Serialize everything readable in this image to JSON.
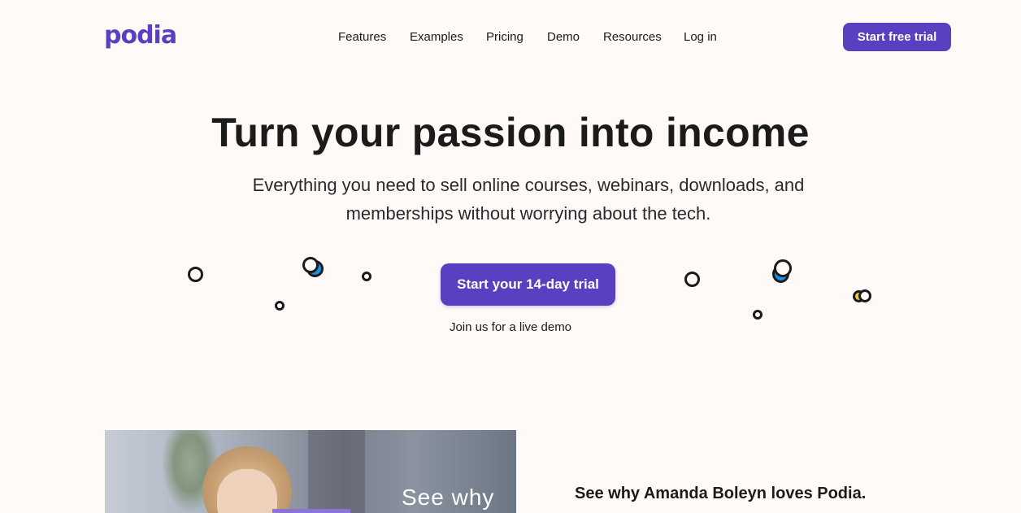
{
  "header": {
    "logo": "podia",
    "nav": [
      {
        "label": "Features"
      },
      {
        "label": "Examples"
      },
      {
        "label": "Pricing"
      },
      {
        "label": "Demo"
      },
      {
        "label": "Resources"
      },
      {
        "label": "Log in"
      }
    ],
    "cta_label": "Start free trial"
  },
  "hero": {
    "title": "Turn your passion into income",
    "subtitle": "Everything you need to sell online courses, webinars, downloads, and memberships without worrying about the tech.",
    "cta_label": "Start your 14-day trial",
    "demo_link": "Join us for a live demo"
  },
  "video": {
    "overlay_text": "See why"
  },
  "testimonial": {
    "title": "See why Amanda Boleyn loves Podia."
  },
  "colors": {
    "brand": "#5a3fc0",
    "background": "#fffaf7",
    "bubble_blue": "#1a8fe3",
    "bubble_yellow": "#f4c542"
  }
}
